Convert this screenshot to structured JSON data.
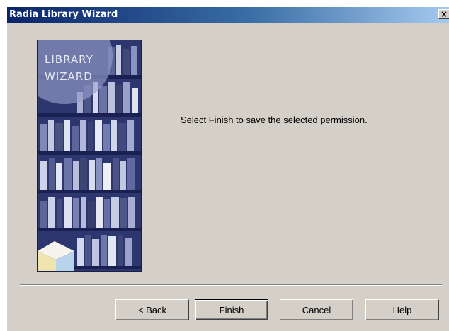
{
  "window": {
    "title": "Radia Library Wizard",
    "close_glyph": "×"
  },
  "sidebar_image": {
    "line1": "LIBRARY",
    "line2": "WIZARD",
    "icon": "box-logo-icon"
  },
  "main": {
    "message": "Select Finish to save the selected permission."
  },
  "buttons": {
    "back_label": "< Back",
    "finish_label": "Finish",
    "cancel_label": "Cancel",
    "help_label": "Help"
  },
  "colors": {
    "dialog_bg": "#d4d0c8",
    "titlebar_start": "#0a246a",
    "titlebar_end": "#a6caf0",
    "image_bg": "#2e3670"
  }
}
